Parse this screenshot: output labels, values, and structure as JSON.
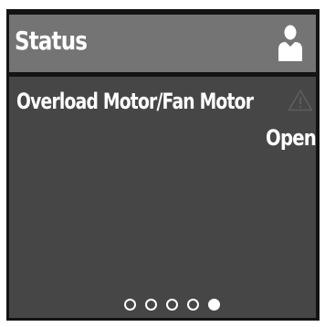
{
  "header": {
    "title": "Status",
    "user_icon": "user-icon"
  },
  "status": {
    "fault_label": "Overload Motor/Fan Motor",
    "fault_value": "Open",
    "warning_icon": "warning-triangle-icon"
  },
  "pager": {
    "page_count": 5,
    "current_page": 5
  },
  "colors": {
    "header_background": "#747474",
    "panel_background": "#464646",
    "frame_background": "#141414",
    "text": "#ffffff",
    "warning_icon": "#5e5e5e"
  }
}
